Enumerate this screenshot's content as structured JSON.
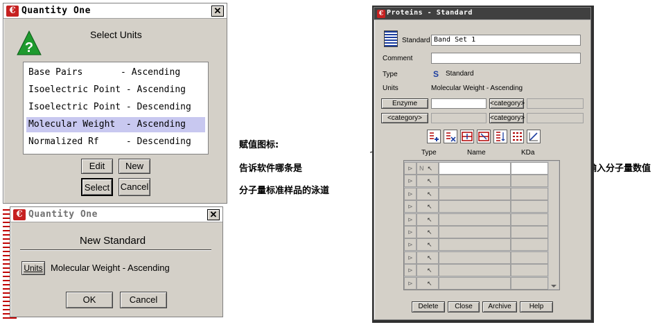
{
  "select_units_dialog": {
    "title": "Quantity One",
    "prompt": "Select Units",
    "items": [
      "Base Pairs       - Ascending",
      "Isoelectric Point - Ascending",
      "Isoelectric Point - Descending",
      "Molecular Weight  - Ascending",
      "Normalized Rf     - Descending"
    ],
    "selected_index": 3,
    "buttons": {
      "edit": "Edit",
      "new": "New",
      "select": "Select",
      "cancel": "Cancel"
    }
  },
  "new_standard_dialog": {
    "title": "Quantity One",
    "heading": "New Standard",
    "units_button": "Units",
    "units_value": "Molecular Weight - Ascending",
    "ok": "OK",
    "cancel": "Cancel"
  },
  "annotations": {
    "left_line1": "赋值图标:",
    "left_line2": "告诉软件哪条是",
    "left_line3": "分子量标准样品的泳道",
    "right": "输入分子量数值"
  },
  "proteins_window": {
    "title": "Proteins - Standard",
    "standard_label": "Standard",
    "standard_value": "Band Set 1",
    "comment_label": "Comment",
    "comment_value": "",
    "type_label": "Type",
    "type_icon": "S",
    "type_value": "Standard",
    "units_label": "Units",
    "units_value": "Molecular Weight - Ascending",
    "enzyme_button": "Enzyme",
    "category_buttons": [
      "<category>",
      "<category>",
      "<category>"
    ],
    "columns": {
      "type": "Type",
      "name": "Name",
      "kda": "KDa"
    },
    "first_row_marker": "N",
    "row_count": 10,
    "buttons": {
      "delete": "Delete",
      "close": "Close",
      "archive": "Archive",
      "help": "Help"
    }
  },
  "colors": {
    "dialog_bg": "#d4d0c8",
    "selection": "#c8c8f0",
    "logo": "#c62020"
  }
}
